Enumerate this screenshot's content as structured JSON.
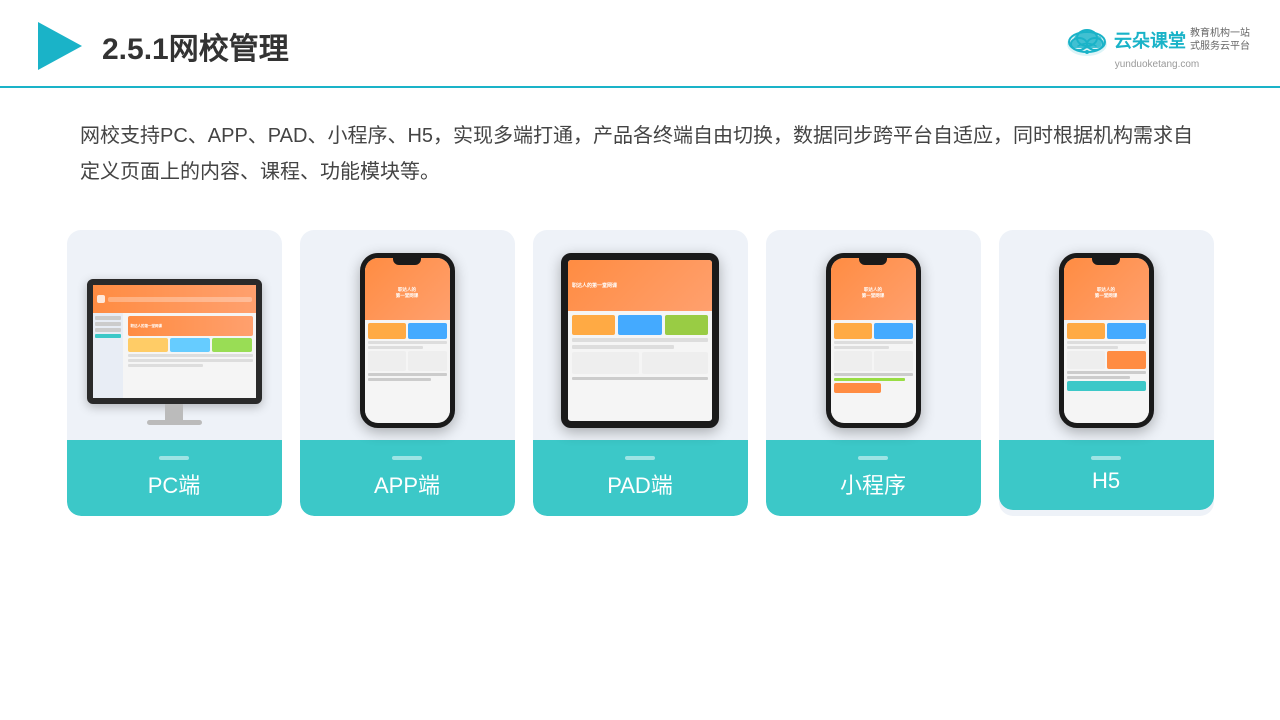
{
  "header": {
    "title": "2.5.1网校管理",
    "logo": {
      "brand_cn": "云朵课堂",
      "url": "yunduoketang.com",
      "sub1": "教育机构一站",
      "sub2": "式服务云平台"
    }
  },
  "description": {
    "text": "网校支持PC、APP、PAD、小程序、H5，实现多端打通，产品各终端自由切换，数据同步跨平台自适应，同时根据机构需求自定义页面上的内容、课程、功能模块等。"
  },
  "cards": [
    {
      "id": "pc",
      "label": "PC端",
      "type": "monitor"
    },
    {
      "id": "app",
      "label": "APP端",
      "type": "phone"
    },
    {
      "id": "pad",
      "label": "PAD端",
      "type": "tablet"
    },
    {
      "id": "miniprogram",
      "label": "小程序",
      "type": "phone"
    },
    {
      "id": "h5",
      "label": "H5",
      "type": "phone"
    }
  ],
  "colors": {
    "teal": "#3cc8c8",
    "teal_dark": "#1ab3c8",
    "orange": "#ff8c42",
    "card_bg": "#eef2f8"
  }
}
